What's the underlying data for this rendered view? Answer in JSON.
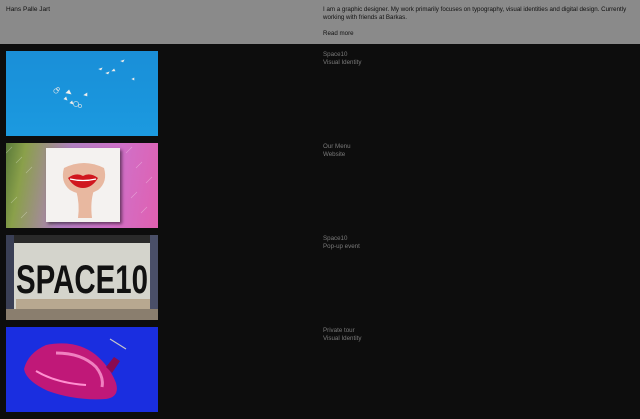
{
  "header": {
    "name": "Hans Palle Jart",
    "bio": "I am a graphic designer. My work primarily focuses on typography, visual identities and digital design. Currently working with friends at Barkas.",
    "read_more": "Read more"
  },
  "projects": [
    {
      "title": "Space10",
      "category": "Visual Identity",
      "thumb_icon": "birds-in-sky-image"
    },
    {
      "title": "Our Menu",
      "category": "Website",
      "thumb_icon": "lips-hand-image"
    },
    {
      "title": "Space10",
      "category": "Pop-up event",
      "thumb_icon": "space10-wall-image"
    },
    {
      "title": "Private tour",
      "category": "Visual Identity",
      "thumb_icon": "pink-shoe-image"
    }
  ],
  "colors": {
    "header_bg": "#8a8a8a",
    "page_bg": "#0d0d0d",
    "meta_text": "#7a7a7a"
  }
}
